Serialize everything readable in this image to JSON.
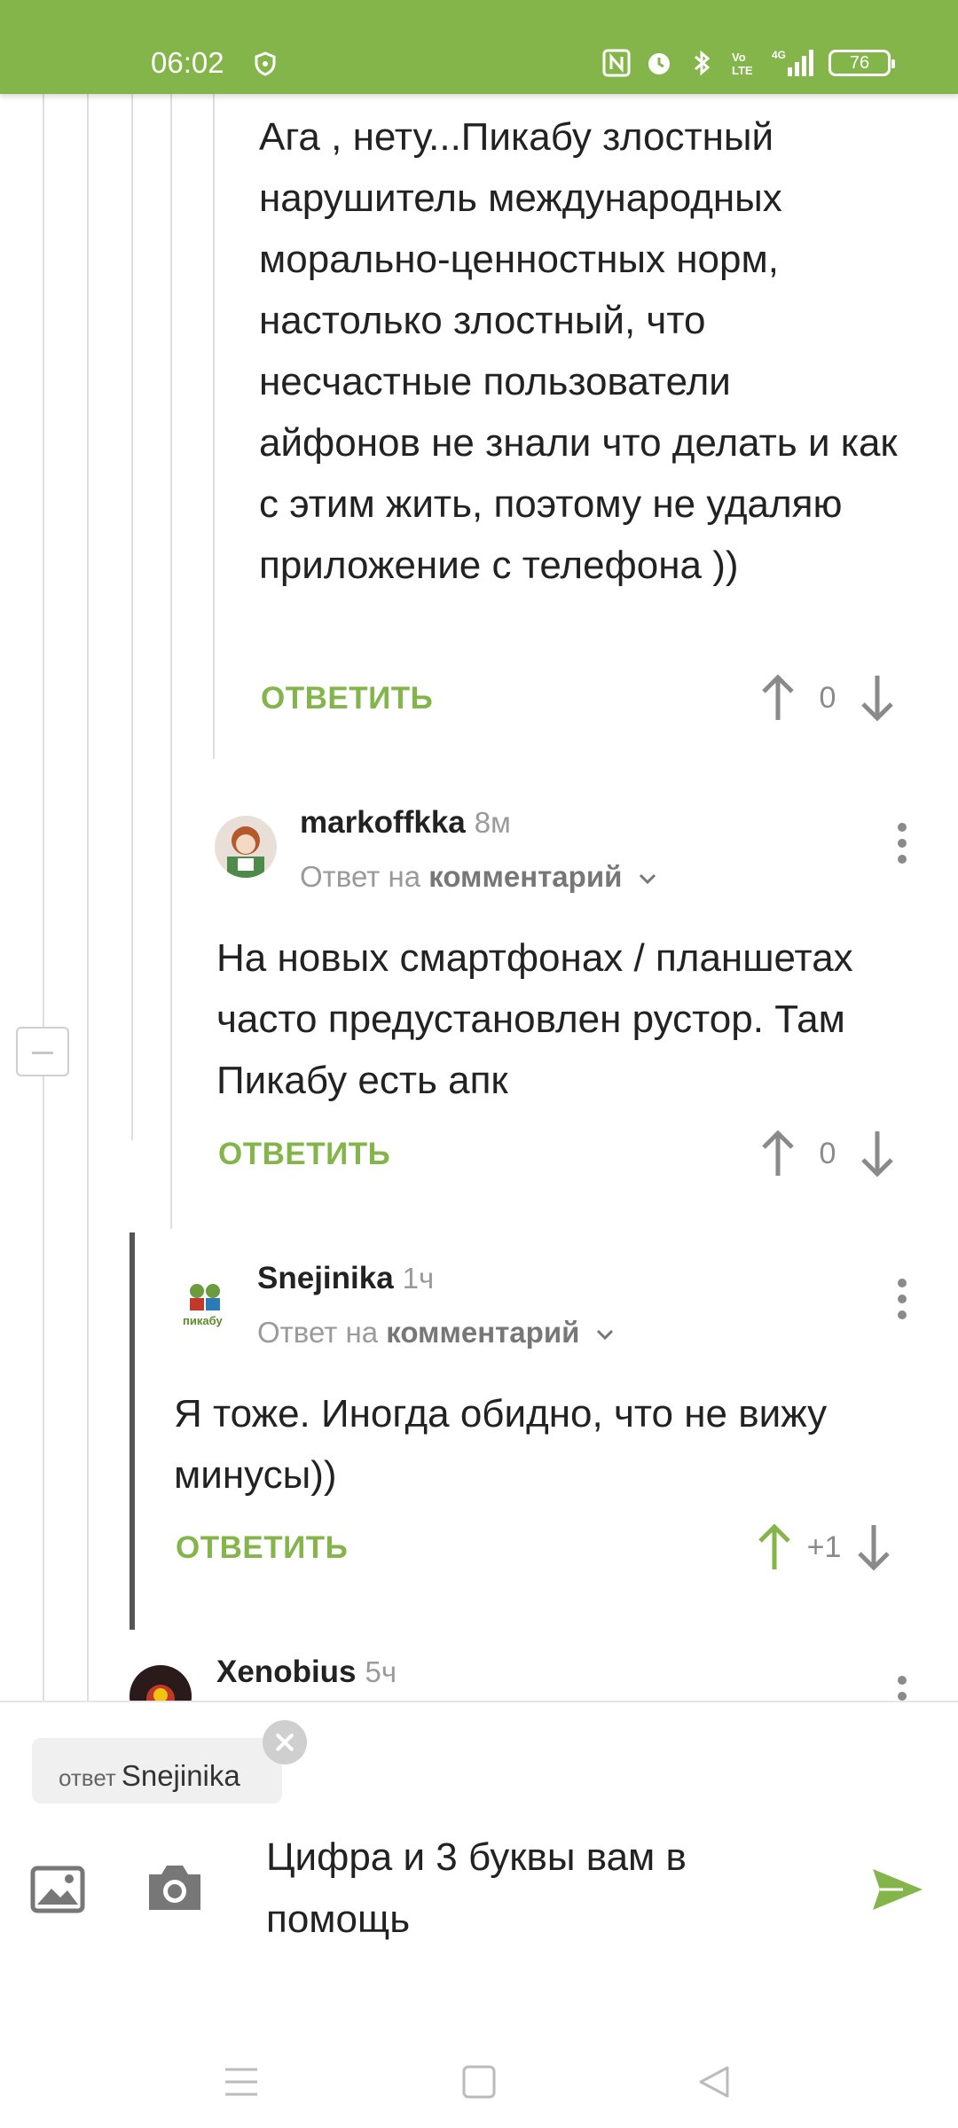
{
  "status_bar": {
    "time": "06:02",
    "battery": "76",
    "icons": [
      "shield-icon",
      "nfc-icon",
      "alarm-icon",
      "bluetooth-icon",
      "volte-icon",
      "4g-signal-icon",
      "battery-icon"
    ]
  },
  "comments": [
    {
      "text": "Ага , нету...Пикабу злостный нарушитель международных морально-ценностных норм, настолько злостный, что несчастные пользователи айфонов не знали что делать и как с этим жить, поэтому не удаляю приложение с телефона ))",
      "reply_label": "ОТВЕТИТЬ",
      "score": "0"
    },
    {
      "author": "markoffkka",
      "time": "8м",
      "reply_prefix": "Ответ на",
      "reply_target": "комментарий",
      "text": "На новых смартфонах / планшетах часто предустановлен рустор. Там Пикабу есть апк",
      "reply_label": "ОТВЕТИТЬ",
      "score": "0"
    },
    {
      "author": "Snejinika",
      "time": "1ч",
      "reply_prefix": "Ответ на",
      "reply_target": "комментарий",
      "text": "Я тоже. Иногда обидно, что не вижу минусы))",
      "reply_label": "ОТВЕТИТЬ",
      "score": "+1"
    },
    {
      "author": "Xenobius",
      "time": "5ч"
    }
  ],
  "composer": {
    "reply_chip_prefix": "ответ",
    "reply_chip_name": "Snejinika",
    "input_text": "Цифра и 3 буквы вам в помощь"
  },
  "colors": {
    "brand_green": "#83b54a",
    "text": "#222222",
    "muted": "#9a9a9a"
  }
}
